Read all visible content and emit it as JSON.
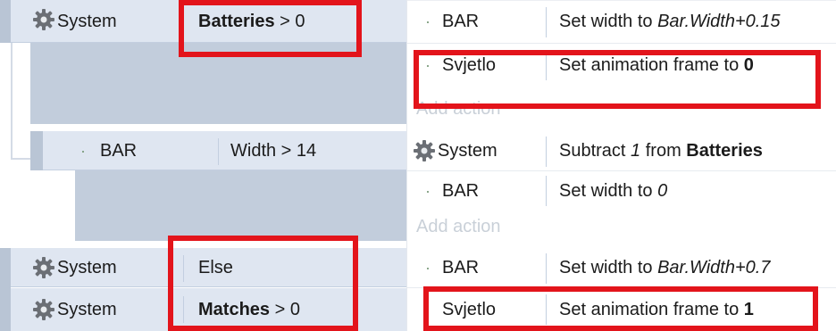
{
  "events": [
    {
      "conditions": [
        {
          "object": "System",
          "icon": "gear-icon",
          "name": "Batteries",
          "op": " > 0"
        }
      ],
      "actions": [
        {
          "object": "BAR",
          "pre": "Set width to ",
          "value": "Bar.Width+0.15"
        },
        {
          "object": "Svjetlo",
          "pre": "Set animation frame to ",
          "value": "0"
        }
      ],
      "add_action_label": "Add action"
    },
    {
      "conditions": [
        {
          "object": "BAR",
          "text": "Width > 14"
        }
      ],
      "actions": [
        {
          "object": "System",
          "icon": "gear-icon",
          "pre": "Subtract ",
          "amount": "1",
          "mid": " from ",
          "var": "Batteries"
        },
        {
          "object": "BAR",
          "pre": "Set width to ",
          "value": "0"
        }
      ],
      "add_action_label": "Add action"
    },
    {
      "conditions": [
        {
          "object": "System",
          "icon": "gear-icon",
          "text": "Else"
        },
        {
          "object": "System",
          "icon": "gear-icon",
          "name": "Matches",
          "op": " > 0"
        }
      ],
      "actions": [
        {
          "object": "BAR",
          "pre": "Set width to ",
          "value": "Bar.Width+0.7"
        },
        {
          "object": "Svjetlo",
          "pre": "Set animation frame to ",
          "value": "1"
        }
      ]
    }
  ],
  "colors": {
    "condition_bg": "#dfe6f1",
    "condition_border": "#c3cfe0",
    "subevent_fill": "#c2cddc",
    "highlight": "#e3141b",
    "add_action_text": "#c9d0d8"
  }
}
